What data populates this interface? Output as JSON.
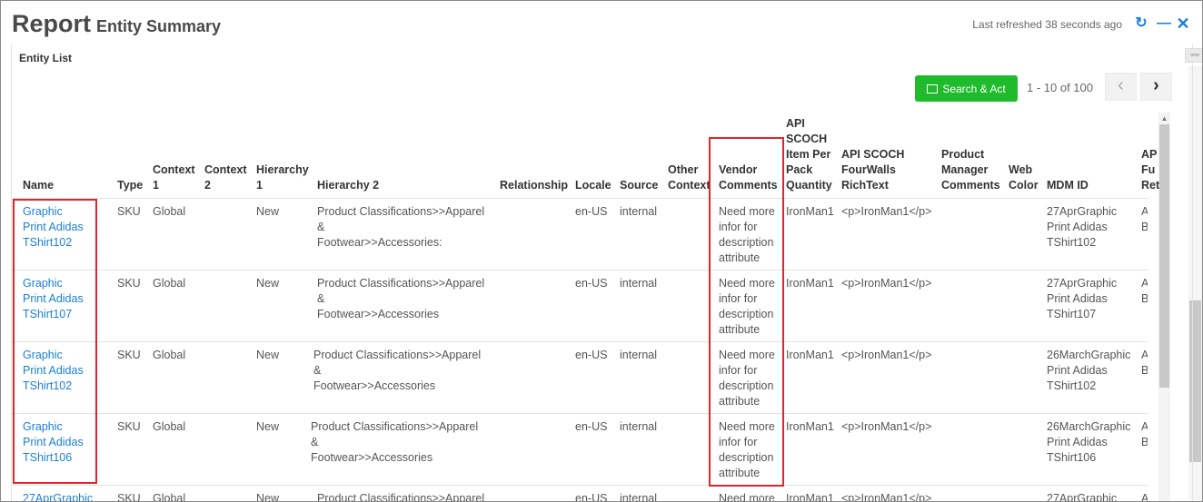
{
  "header": {
    "title": "Report",
    "subtitle": "Entity Summary",
    "refreshed": "Last refreshed 38 seconds ago"
  },
  "panel": {
    "title": "Entity List",
    "search_label": "Search & Act",
    "pagination": "1 - 10 of 100"
  },
  "columns": {
    "name": "Name",
    "type": "Type",
    "context1": [
      "Context",
      "1"
    ],
    "context2": [
      "Context",
      "2"
    ],
    "hierarchy1": [
      "Hierarchy",
      "1"
    ],
    "hierarchy2": "Hierarchy 2",
    "relationship": "Relationship",
    "locale": "Locale",
    "source": "Source",
    "other_context": [
      "Other",
      "Context"
    ],
    "vendor_comments": [
      "Vendor",
      "Comments"
    ],
    "api_item": [
      "API",
      "SCOCH",
      "Item Per",
      "Pack",
      "Quantity"
    ],
    "api_fourwalls": [
      "API SCOCH",
      "FourWalls",
      "RichText"
    ],
    "pm_comments": [
      "Product",
      "Manager",
      "Comments"
    ],
    "web_color": [
      "Web",
      "Color"
    ],
    "mdm_id": "MDM ID",
    "api_partial": [
      "AP",
      "Fu",
      "Ret"
    ]
  },
  "rows": [
    {
      "name": [
        "Graphic",
        "Print Adidas",
        "TShirt102"
      ],
      "type": "SKU",
      "context1": "Global",
      "hierarchy1": "New",
      "hierarchy2": [
        "Product Classifications>>Apparel",
        "&",
        "Footwear>>Accessories:"
      ],
      "locale": "en-US",
      "source": "internal",
      "vendor": [
        "Need more",
        "infor for",
        "description",
        "attribute"
      ],
      "api_item": "IronMan1",
      "api_fourwalls": "<p>IronMan1</p>",
      "mdm": [
        "27AprGraphic",
        "Print Adidas",
        "TShirt102"
      ],
      "api_partial": [
        "Alis",
        "Blu"
      ]
    },
    {
      "name": [
        "Graphic",
        "Print Adidas",
        "TShirt107"
      ],
      "type": "SKU",
      "context1": "Global",
      "hierarchy1": "New",
      "hierarchy2": [
        "Product Classifications>>Apparel",
        "&",
        "Footwear>>Accessories"
      ],
      "locale": "en-US",
      "source": "internal",
      "vendor": [
        "Need more",
        "infor for",
        "description",
        "attribute"
      ],
      "api_item": "IronMan1",
      "api_fourwalls": "<p>IronMan1</p>",
      "mdm": [
        "27AprGraphic",
        "Print Adidas",
        "TShirt107"
      ],
      "api_partial": [
        "Alis",
        "Blu"
      ]
    },
    {
      "name": [
        "Graphic",
        "Print Adidas",
        "TShirt102"
      ],
      "type": "SKU",
      "context1": "Global",
      "hierarchy1": "New",
      "hierarchy2": [
        "Product Classifications>>Apparel",
        "&",
        "Footwear>>Accessories"
      ],
      "locale": "en-US",
      "source": "internal",
      "vendor": [
        "Need more",
        "infor for",
        "description",
        "attribute"
      ],
      "api_item": "IronMan1",
      "api_fourwalls": "<p>IronMan1</p>",
      "mdm": [
        "26MarchGraphic",
        "Print Adidas",
        "TShirt102"
      ],
      "api_partial": [
        "Alis",
        "Blu"
      ]
    },
    {
      "name": [
        "Graphic",
        "Print Adidas",
        "TShirt106"
      ],
      "type": "SKU",
      "context1": "Global",
      "hierarchy1": "New",
      "hierarchy2": [
        "Product Classifications>>Apparel",
        "&",
        "Footwear>>Accessories"
      ],
      "locale": "en-US",
      "source": "internal",
      "vendor": [
        "Need more",
        "infor for",
        "description",
        "attribute"
      ],
      "api_item": "IronMan1",
      "api_fourwalls": "<p>IronMan1</p>",
      "mdm": [
        "26MarchGraphic",
        "Print Adidas",
        "TShirt106"
      ],
      "api_partial": [
        "Alis",
        "Blu"
      ]
    },
    {
      "name": [
        "27AprGraphic"
      ],
      "type": "SKU",
      "context1": "Global",
      "hierarchy1": "New",
      "hierarchy2": [
        "Product Classifications>>Apparel"
      ],
      "locale": "en-US",
      "source": "internal",
      "vendor": [
        "Need more"
      ],
      "api_item": "IronMan1",
      "api_fourwalls": "<p>IronMan1</p>",
      "mdm": [
        "27AprGraphic"
      ],
      "api_partial": [
        "Alis"
      ]
    }
  ],
  "colors": {
    "accent": "#1b7fd6",
    "search_button": "#1fbb2c",
    "highlight": "#e0262a"
  }
}
